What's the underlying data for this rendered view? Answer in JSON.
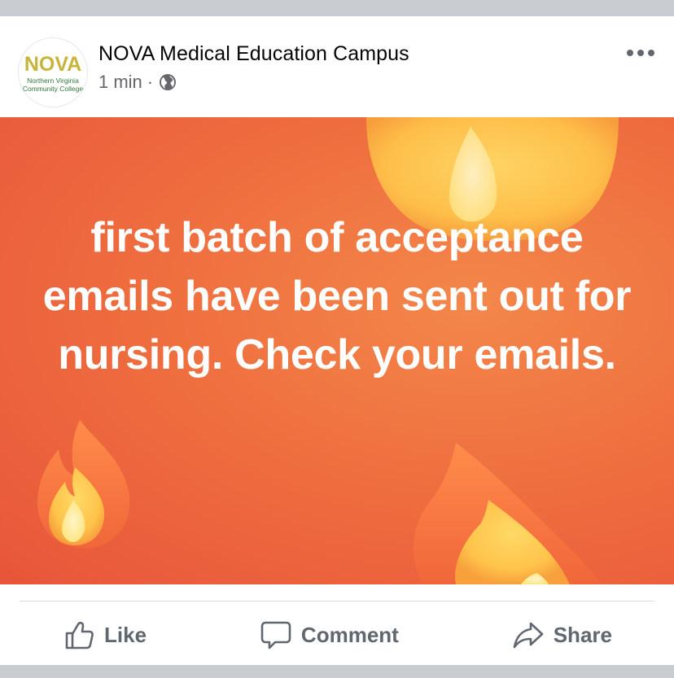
{
  "post": {
    "author": "NOVA Medical Education Campus",
    "time": "1 min",
    "separator": "·",
    "privacy_icon": "globe-icon",
    "menu_icon": "more-options-icon",
    "avatar": {
      "logo_text": "NOVA",
      "line1": "Northern Virginia",
      "line2": "Community College"
    },
    "text": "first batch of acceptance emails have been sent out for nursing. Check your emails.",
    "banner_colors": {
      "start": "#f3874a",
      "end": "#e8553a"
    }
  },
  "actions": {
    "like_label": "Like",
    "comment_label": "Comment",
    "share_label": "Share",
    "like_icon": "thumbs-up-icon",
    "comment_icon": "speech-bubble-icon",
    "share_icon": "share-arrow-icon"
  },
  "colors": {
    "text_primary": "#050505",
    "text_secondary": "#65676b",
    "action_text": "#606770",
    "background": "#c9ccd1"
  }
}
